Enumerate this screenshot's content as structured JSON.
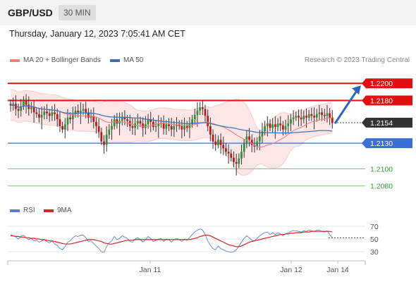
{
  "header": {
    "pair": "GBP/USD",
    "timeframe": "30 MIN"
  },
  "datetime": "Thursday, January 12, 2023 7:05:41 AM CET",
  "legend": {
    "bollinger": "MA 20 + Bollinger Bands",
    "ma50": "MA 50",
    "rsi": "RSI",
    "rsi_ma": "9MA",
    "credit": "Research © 2023 Trading Central"
  },
  "colors": {
    "candle_up": "#2f8f3a",
    "candle_down": "#b71c1c",
    "bollinger": "#f08080",
    "ma50": "#3a6fb0",
    "resistance": "#e01010",
    "support_blue": "#3b6ed6",
    "support_green": "#2e9a2e",
    "arrow": "#2d66b8",
    "rsi": "#5b7fd6",
    "rsi_ma": "#d92222"
  },
  "chart_data": [
    {
      "type": "candlestick",
      "x": [
        "Jan 11",
        "Jan 12",
        "Jan 14"
      ],
      "y_range": [
        1.2065,
        1.2215
      ],
      "current_price": 1.2154,
      "levels": [
        {
          "value": 1.22,
          "label": "1.2200",
          "kind": "resistance"
        },
        {
          "value": 1.218,
          "label": "1.2180",
          "kind": "resistance"
        },
        {
          "value": 1.2154,
          "label": "1.2154",
          "kind": "current"
        },
        {
          "value": 1.213,
          "label": "1.2130",
          "kind": "support"
        },
        {
          "value": 1.21,
          "label": "1.2100",
          "kind": "support"
        },
        {
          "value": 1.208,
          "label": "1.2080",
          "kind": "support"
        }
      ],
      "projection": {
        "from": 1.2153,
        "to": 1.22
      },
      "series": [
        {
          "name": "MA 20 + Bollinger Bands"
        },
        {
          "name": "MA 50"
        }
      ],
      "candles_close": [
        1.2174,
        1.2176,
        1.217,
        1.2168,
        1.2173,
        1.218,
        1.2175,
        1.217,
        1.2172,
        1.2166,
        1.2164,
        1.216,
        1.2163,
        1.2167,
        1.2165,
        1.2162,
        1.2166,
        1.2164,
        1.2158,
        1.215,
        1.2146,
        1.2152,
        1.216,
        1.2158,
        1.2164,
        1.2168,
        1.2166,
        1.2168,
        1.217,
        1.2166,
        1.216,
        1.2162,
        1.2155,
        1.215,
        1.2143,
        1.2132,
        1.2128,
        1.214,
        1.2146,
        1.215,
        1.2158,
        1.2153,
        1.2156,
        1.216,
        1.2158,
        1.2156,
        1.215,
        1.2148,
        1.2153,
        1.2156,
        1.2153,
        1.2148,
        1.2152,
        1.2158,
        1.2155,
        1.2149,
        1.215,
        1.2153,
        1.2154,
        1.2147,
        1.2152,
        1.215,
        1.2146,
        1.215,
        1.2152,
        1.215,
        1.2146,
        1.215,
        1.2148,
        1.2152,
        1.2158,
        1.2163,
        1.2168,
        1.2172,
        1.217,
        1.2162,
        1.215,
        1.214,
        1.2132,
        1.2128,
        1.2134,
        1.2128,
        1.2124,
        1.212,
        1.2118,
        1.2113,
        1.2108,
        1.2106,
        1.2112,
        1.212,
        1.213,
        1.2138,
        1.2134,
        1.2128,
        1.2126,
        1.2132,
        1.2138,
        1.2144,
        1.215,
        1.2153,
        1.2148,
        1.2152,
        1.2149,
        1.2153,
        1.2151,
        1.2146,
        1.215,
        1.2153,
        1.2158,
        1.216,
        1.2162,
        1.216,
        1.2158,
        1.2162,
        1.216,
        1.2164,
        1.2162,
        1.216,
        1.2164,
        1.2166,
        1.2163,
        1.2162,
        1.2165,
        1.216,
        1.2154
      ],
      "ylabel": ""
    },
    {
      "type": "line",
      "title": "RSI",
      "ticks": [
        70,
        50,
        30
      ],
      "y_range": [
        20,
        80
      ],
      "series": [
        {
          "name": "RSI",
          "values": [
            57,
            55,
            53,
            50,
            54,
            56,
            52,
            49,
            51,
            47,
            48,
            45,
            47,
            49,
            46,
            44,
            47,
            42,
            40,
            35,
            33,
            38,
            45,
            47,
            52,
            55,
            54,
            56,
            56,
            52,
            46,
            47,
            43,
            39,
            35,
            30,
            29,
            38,
            44,
            47,
            54,
            49,
            51,
            55,
            53,
            51,
            46,
            45,
            50,
            52,
            49,
            45,
            49,
            54,
            51,
            46,
            48,
            50,
            51,
            46,
            50,
            49,
            45,
            49,
            51,
            49,
            46,
            50,
            48,
            52,
            57,
            61,
            64,
            66,
            64,
            57,
            47,
            40,
            35,
            33,
            39,
            35,
            33,
            31,
            30,
            29,
            30,
            33,
            39,
            45,
            51,
            55,
            52,
            48,
            47,
            51,
            55,
            58,
            60,
            61,
            57,
            60,
            57,
            60,
            58,
            55,
            58,
            60,
            62,
            63,
            63,
            62,
            61,
            63,
            62,
            64,
            63,
            62,
            64,
            64,
            62,
            61,
            63,
            57,
            52
          ]
        },
        {
          "name": "9MA",
          "values": [
            55,
            55,
            54,
            54,
            53,
            53,
            52,
            52,
            51,
            51,
            50,
            50,
            49,
            49,
            48,
            47,
            47,
            46,
            45,
            44,
            43,
            42,
            42,
            42,
            43,
            44,
            45,
            46,
            47,
            48,
            49,
            49,
            49,
            48,
            47,
            46,
            44,
            43,
            42,
            42,
            43,
            44,
            45,
            46,
            47,
            48,
            48,
            48,
            49,
            49,
            49,
            49,
            49,
            49,
            49,
            49,
            49,
            49,
            49,
            49,
            49,
            49,
            49,
            49,
            49,
            49,
            49,
            49,
            49,
            49,
            50,
            51,
            52,
            54,
            55,
            56,
            56,
            55,
            53,
            51,
            49,
            47,
            45,
            43,
            41,
            40,
            39,
            38,
            38,
            39,
            41,
            43,
            45,
            46,
            47,
            48,
            49,
            50,
            51,
            52,
            53,
            54,
            55,
            56,
            57,
            57,
            58,
            58,
            59,
            59,
            60,
            60,
            60,
            61,
            61,
            61,
            62,
            62,
            62,
            62,
            62,
            62,
            62,
            62,
            61
          ]
        }
      ]
    }
  ]
}
